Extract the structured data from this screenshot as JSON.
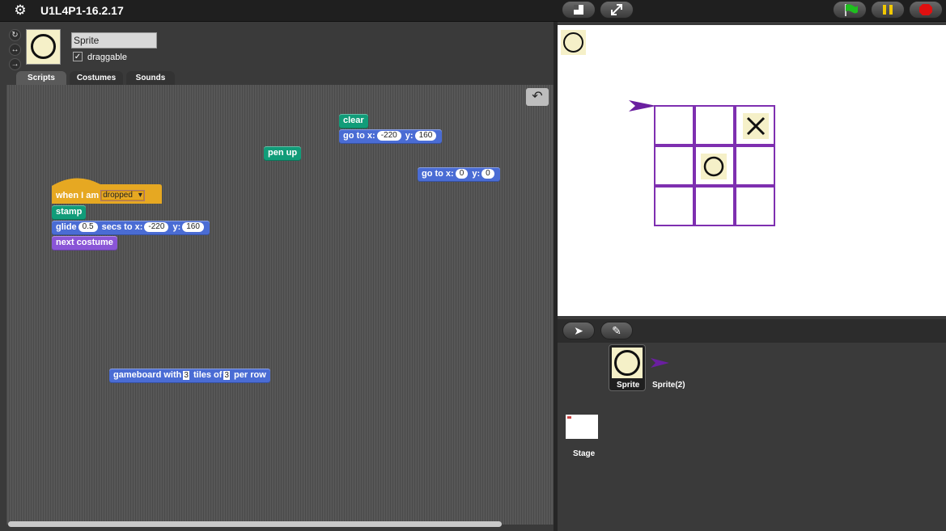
{
  "window": {
    "title": "U1L4P1-16.2.17"
  },
  "sprite": {
    "name": "Sprite",
    "draggable_label": "draggable",
    "draggable": true
  },
  "tabs": [
    "Scripts",
    "Costumes",
    "Sounds"
  ],
  "blocks": {
    "clear": "clear",
    "goto1": {
      "label": "go to x:",
      "x": "-220",
      "ylabel": "y:",
      "y": "160"
    },
    "penup": "pen up",
    "goto2": {
      "label": "go to x:",
      "x": "0",
      "ylabel": "y:",
      "y": "0"
    },
    "hat": {
      "label": "when I am",
      "option": "dropped"
    },
    "stamp": "stamp",
    "glide": {
      "label": "glide",
      "secs": "0.5",
      "mid": "secs to x:",
      "x": "-220",
      "ylabel": "y:",
      "y": "160"
    },
    "nextcostume": "next costume",
    "gameboard": {
      "label": "gameboard with",
      "n1": "3",
      "mid": "tiles of",
      "n2": "3",
      "end": "per row"
    }
  },
  "stage": {
    "board_marks": [
      {
        "row": 0,
        "col": 2,
        "mark": "X"
      },
      {
        "row": 1,
        "col": 1,
        "mark": "O"
      }
    ]
  },
  "corral": {
    "sprites": [
      "Sprite",
      "Sprite(2)"
    ],
    "stage_label": "Stage"
  },
  "icons": {
    "logo": "gear-icon",
    "presentation": "presentation-mode-icon",
    "fullscreen": "fullscreen-icon",
    "green_flag": "green-flag-icon",
    "pause": "pause-icon",
    "stop": "stop-icon",
    "undo": "undo-icon",
    "turtle": "turtle-icon",
    "paintbrush": "paintbrush-icon"
  },
  "colors": {
    "pen": "#119c79",
    "motion": "#4a6cd4",
    "looks": "#8a55d7",
    "control": "#e6a822",
    "grid": "#7e2fb0"
  }
}
